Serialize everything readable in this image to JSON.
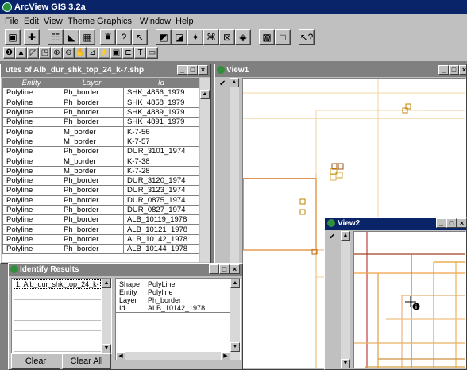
{
  "app": {
    "title": "ArcView GIS 3.2a"
  },
  "menu": [
    "File",
    "Edit",
    "View",
    "Theme",
    "Graphics",
    "Window",
    "Help"
  ],
  "attr_window": {
    "title": "utes of Alb_dur_shk_top_24_k-7.shp",
    "columns": [
      "Entity",
      "Layer",
      "Id"
    ],
    "rows": [
      [
        "Polyline",
        "Ph_border",
        "SHK_4856_1979"
      ],
      [
        "Polyline",
        "Ph_border",
        "SHK_4858_1979"
      ],
      [
        "Polyline",
        "Ph_border",
        "SHK_4889_1979"
      ],
      [
        "Polyline",
        "Ph_border",
        "SHK_4891_1979"
      ],
      [
        "Polyline",
        "M_border",
        "K-7-56"
      ],
      [
        "Polyline",
        "M_border",
        "K-7-57"
      ],
      [
        "Polyline",
        "Ph_border",
        "DUR_3101_1974"
      ],
      [
        "Polyline",
        "M_border",
        "K-7-38"
      ],
      [
        "Polyline",
        "M_border",
        "K-7-28"
      ],
      [
        "Polyline",
        "Ph_border",
        "DUR_3120_1974"
      ],
      [
        "Polyline",
        "Ph_border",
        "DUR_3123_1974"
      ],
      [
        "Polyline",
        "Ph_border",
        "DUR_0875_1974"
      ],
      [
        "Polyline",
        "Ph_border",
        "DUR_0827_1974"
      ],
      [
        "Polyline",
        "Ph_border",
        "ALB_10119_1978"
      ],
      [
        "Polyline",
        "Ph_border",
        "ALB_10121_1978"
      ],
      [
        "Polyline",
        "Ph_border",
        "ALB_10142_1978"
      ],
      [
        "Polyline",
        "Ph_border",
        "ALB_10144_1978"
      ]
    ]
  },
  "identify": {
    "title": "Identify Results",
    "list_item": "1: Alb_dur_shk_top_24_k-",
    "fields": [
      [
        "Shape",
        "PolyLine"
      ],
      [
        "Entity",
        "Polyline"
      ],
      [
        "Layer",
        "Ph_border"
      ],
      [
        "Id",
        "ALB_10142_1978"
      ]
    ],
    "clear_label": "Clear",
    "clear_all_label": "Clear All"
  },
  "view1": {
    "title": "View1"
  },
  "view2": {
    "title": "View2"
  },
  "colors": {
    "title_active": "#0a246a",
    "title_inactive": "#808080"
  },
  "icons": [
    "save-icon",
    "add-theme-icon",
    "properties-icon",
    "legend-icon",
    "table-icon",
    "find-icon",
    "query-icon",
    "pointer-icon",
    "zoom-icon",
    "help-icon"
  ]
}
